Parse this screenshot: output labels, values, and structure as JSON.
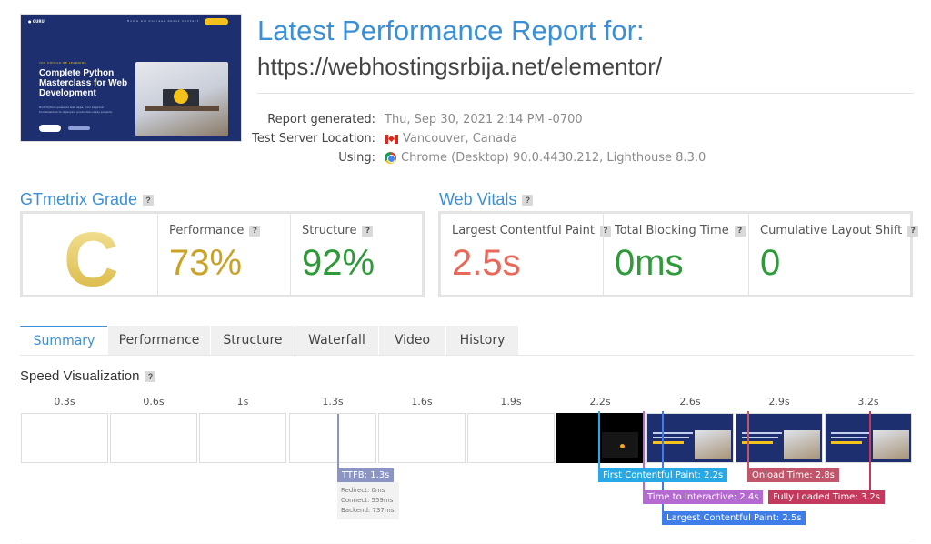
{
  "header": {
    "title": "Latest Performance Report for:",
    "url": "https://webhostingsrbija.net/elementor/",
    "thumbnail": {
      "logo": "● GURU",
      "nav_links": "Home  All Courses  About  Contact",
      "kicker": "YOU SHOULD BE LEARNING",
      "headline": "Complete Python Masterclass for Web Development",
      "subtext": "Build Python-powered web apps, from beginner fundamentals to deploying production-ready projects."
    }
  },
  "meta": {
    "labels": [
      "Report generated:",
      "Test Server Location:",
      "Using:"
    ],
    "generated": "Thu, Sep 30, 2021 2:14 PM -0700",
    "location": "Vancouver, Canada",
    "using": "Chrome (Desktop) 90.0.4430.212, Lighthouse 8.3.0"
  },
  "grade": {
    "title": "GTmetrix Grade",
    "letter": "C",
    "performance_label": "Performance",
    "performance_value": "73%",
    "structure_label": "Structure",
    "structure_value": "92%"
  },
  "vitals": {
    "title": "Web Vitals",
    "lcp_label": "Largest Contentful Paint",
    "lcp_value": "2.5s",
    "tbt_label": "Total Blocking Time",
    "tbt_value": "0ms",
    "cls_label": "Cumulative Layout Shift",
    "cls_value": "0"
  },
  "help_glyph": "?",
  "tabs": [
    "Summary",
    "Performance",
    "Structure",
    "Waterfall",
    "Video",
    "History"
  ],
  "speed": {
    "title": "Speed Visualization",
    "ticks": [
      "0.3s",
      "0.6s",
      "1s",
      "1.3s",
      "1.6s",
      "1.9s",
      "2.2s",
      "2.6s",
      "2.9s",
      "3.2s"
    ],
    "markers": {
      "ttfb": "TTFB: 1.3s",
      "fcp": "First Contentful Paint: 2.2s",
      "tti": "Time to Interactive: 2.4s",
      "lcp": "Largest Contentful Paint: 2.5s",
      "onload": "Onload Time: 2.8s",
      "fully_loaded": "Fully Loaded Time: 3.2s"
    },
    "ttfb_detail": {
      "redirect": "Redirect: 0ms",
      "connect": "Connect: 559ms",
      "backend": "Backend: 737ms"
    }
  },
  "colors": {
    "accent": "#3b8fd6",
    "grade_c": "#d8b43c",
    "performance": "#c9a227",
    "structure": "#2e9a3a",
    "lcp": "#e8685a",
    "good": "#2e9a3a",
    "ttfb": "#8a95c4",
    "fcp": "#29a8e6",
    "tti": "#b46ad0",
    "lcp_marker": "#3f7ee8",
    "onload": "#c1566b",
    "fully_loaded": "#c43a5c"
  }
}
